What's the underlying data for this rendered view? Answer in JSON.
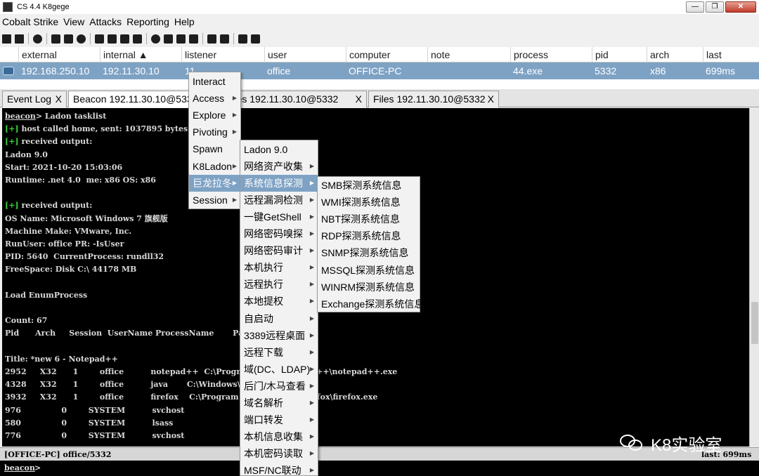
{
  "window": {
    "title": "CS 4.4 K8gege",
    "controls": [
      "—",
      "❐",
      "✕"
    ]
  },
  "menubar": [
    "Cobalt Strike",
    "View",
    "Attacks",
    "Reporting",
    "Help"
  ],
  "table": {
    "columns": [
      "external",
      "internal ▲",
      "listener",
      "user",
      "computer",
      "note",
      "process",
      "pid",
      "arch",
      "last"
    ],
    "row": {
      "external": "192.168.250.10",
      "internal": "192.11.30.10",
      "listener": "11",
      "user": "office",
      "computer": "OFFICE-PC",
      "note": "",
      "process": "44.exe",
      "pid": "5332",
      "arch": "x86",
      "last": "699ms"
    }
  },
  "tabs": [
    {
      "label": "Event Log",
      "close": "X"
    },
    {
      "label": "Beacon 192.11.30.10@5332",
      "close": "X"
    },
    {
      "label": "Processes 192.11.30.10@5332",
      "close": "X"
    },
    {
      "label": "Files 192.11.30.10@5332",
      "close": "X"
    }
  ],
  "console": {
    "lines": [
      {
        "prompt": "beacon",
        "text": "> Ladon tasklist"
      },
      {
        "tag": "[+]",
        "text": " host called home, sent: 1037895 bytes"
      },
      {
        "tag": "[+]",
        "text": " received output:"
      },
      {
        "text": "Ladon 9.0"
      },
      {
        "text": "Start: 2021-10-20 15:03:06"
      },
      {
        "text": "Runtime: .net 4.0  me: x86 OS: x86"
      },
      {
        "text": ""
      },
      {
        "tag": "[+]",
        "text": " received output:"
      },
      {
        "text": "OS Name: Microsoft Windows 7 旗舰版"
      },
      {
        "text": "Machine Make: VMware, Inc."
      },
      {
        "text": "RunUser: office PR: -IsUser"
      },
      {
        "text": "PID: 5640  CurrentProcess: rundll32"
      },
      {
        "text": "FreeSpace: Disk C:\\ 44178 MB"
      },
      {
        "text": ""
      },
      {
        "text": "Load EnumProcess"
      },
      {
        "text": ""
      },
      {
        "text": "Count: 67"
      },
      {
        "text": "Pid      Arch     Session  UserName ProcessName       Path"
      },
      {
        "text": ""
      },
      {
        "text": "Title: *new 6 - Notepad++"
      },
      {
        "text": "2952     X32      1        office          notepad++  C:\\Program Files\\Notepad++\\notepad++.exe"
      },
      {
        "text": "4328     X32      1        office          java       C:\\Windows\\system32\\java.exe"
      },
      {
        "text": "3932     X32      1        office          firefox    C:\\Program Files\\Mozilla Firefox\\firefox.exe"
      },
      {
        "text": "976               0        SYSTEM          svchost"
      },
      {
        "text": "580               0        SYSTEM          lsass"
      },
      {
        "text": "776               0        SYSTEM          svchost"
      }
    ],
    "status_left": "[OFFICE-PC] office/5332",
    "status_right": "last: 699ms",
    "prompt": "beacon",
    "prompt_suffix": ">"
  },
  "context_menu": [
    "Interact",
    "Access",
    "Explore",
    "Pivoting",
    "Spawn",
    "K8Ladon",
    "巨龙拉冬",
    "Session"
  ],
  "submenu_ladon": [
    "Ladon 9.0",
    "网络资产收集",
    "系统信息探测",
    "远程漏洞检测",
    "一键GetShell",
    "网络密码嗅探",
    "网络密码审计",
    "本机执行",
    "远程执行",
    "本地提权",
    "自启动",
    "3389远程桌面",
    "远程下载",
    "域(DC、LDAP)",
    "后门/木马查看",
    "域名解析",
    "端口转发",
    "本机信息收集",
    "本机密码读取",
    "MSF/NC联动"
  ],
  "submenu_sysinfo": [
    "SMB探测系统信息",
    "WMI探测系统信息",
    "NBT探测系统信息",
    "RDP探测系统信息",
    "SNMP探测系统信息",
    "MSSQL探测系统信息",
    "WINRM探测系统信息",
    "Exchange探测系统信息"
  ],
  "watermark": "K8实验室",
  "colors": {
    "selection": "#7ea2c4",
    "console_bg": "#000000",
    "prompt_green": "#36d136"
  }
}
